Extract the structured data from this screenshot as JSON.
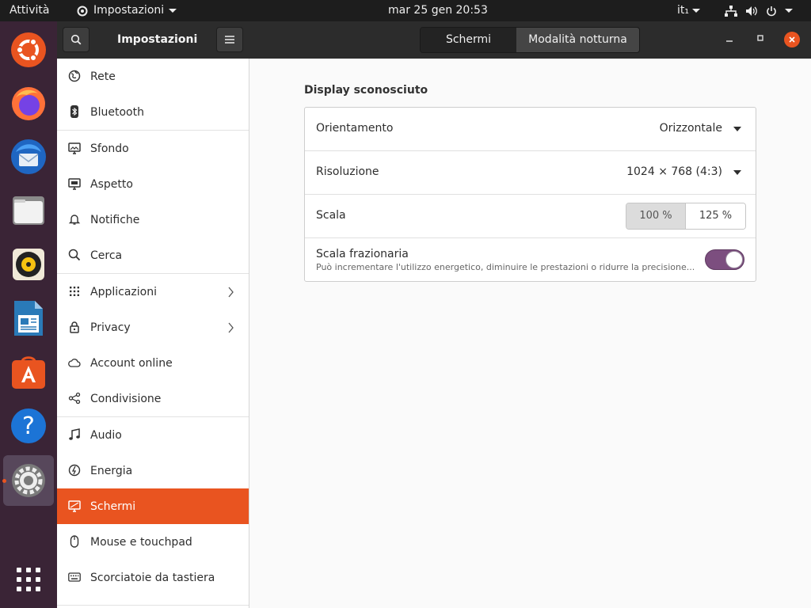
{
  "topbar": {
    "activities": "Attività",
    "app_menu": "Impostazioni",
    "clock": "mar 25 gen  20:53",
    "lang": "it₁"
  },
  "dock": {
    "apps": [
      "ubuntu-logo-icon",
      "firefox-icon",
      "thunderbird-icon",
      "files-icon",
      "rhythmbox-icon",
      "libreoffice-writer-icon",
      "software-center-icon",
      "help-icon",
      "settings-icon",
      "show-applications-icon"
    ]
  },
  "headerbar": {
    "title": "Impostazioni",
    "tabs": [
      {
        "label": "Schermi",
        "selected": true
      },
      {
        "label": "Modalità notturna",
        "selected": false
      }
    ]
  },
  "sidebar": {
    "items": [
      {
        "label": "Rete",
        "icon": "network-icon"
      },
      {
        "label": "Bluetooth",
        "icon": "bluetooth-icon"
      },
      {
        "label": "Sfondo",
        "icon": "background-icon"
      },
      {
        "label": "Aspetto",
        "icon": "appearance-icon"
      },
      {
        "label": "Notifiche",
        "icon": "bell-icon"
      },
      {
        "label": "Cerca",
        "icon": "search-icon"
      },
      {
        "label": "Applicazioni",
        "icon": "apps-grid-icon"
      },
      {
        "label": "Privacy",
        "icon": "lock-icon"
      },
      {
        "label": "Account online",
        "icon": "cloud-icon"
      },
      {
        "label": "Condivisione",
        "icon": "share-icon"
      },
      {
        "label": "Audio",
        "icon": "music-note-icon"
      },
      {
        "label": "Energia",
        "icon": "power-icon"
      },
      {
        "label": "Schermi",
        "icon": "display-icon"
      },
      {
        "label": "Mouse e touchpad",
        "icon": "mouse-icon"
      },
      {
        "label": "Scorciatoie da tastiera",
        "icon": "keyboard-icon"
      }
    ],
    "selected": "Schermi"
  },
  "display": {
    "title": "Display sconosciuto",
    "orientation_label": "Orientamento",
    "orientation_value": "Orizzontale",
    "resolution_label": "Risoluzione",
    "resolution_value": "1024 × 768 (4:3)",
    "scale_label": "Scala",
    "scale_options": [
      "100 %",
      "125 %"
    ],
    "scale_selected": "100 %",
    "fractional_label": "Scala frazionaria",
    "fractional_desc": "Può incrementare l'utilizzo energetico, diminuire le prestazioni o ridurre la precisione...",
    "fractional_enabled": true
  },
  "colors": {
    "accent": "#e95420",
    "toggle_on": "#7c4e7f",
    "dock_bg": "#3a2436"
  }
}
